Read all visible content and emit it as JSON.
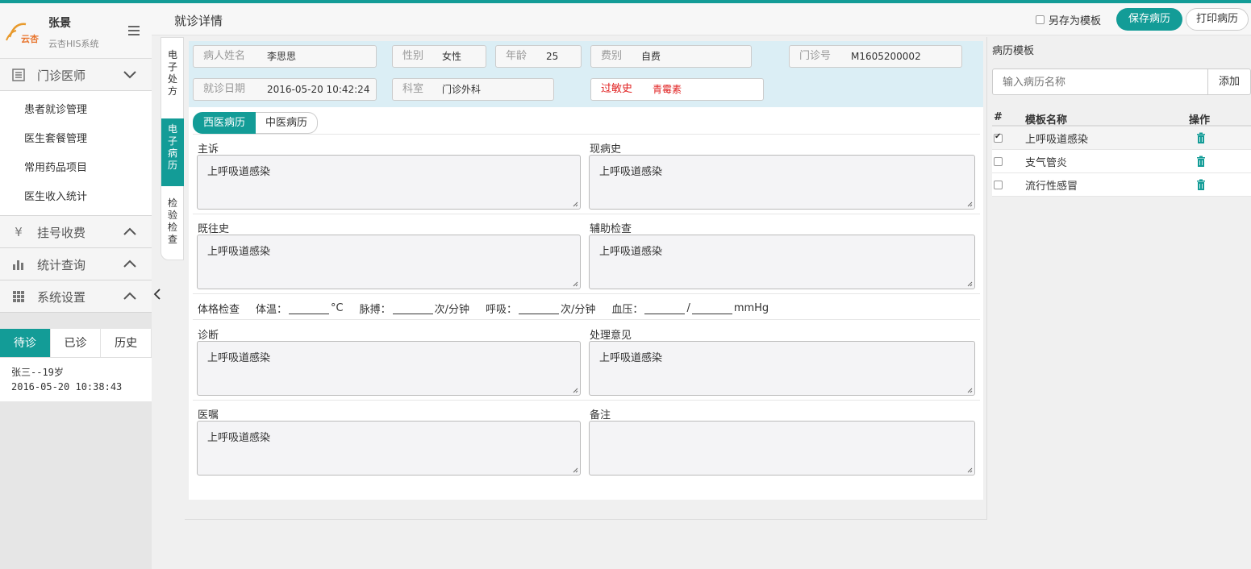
{
  "colors": {
    "accent": "#139c97",
    "allergy": "#e02020"
  },
  "sidebar": {
    "logo_text": "云杏",
    "user_name": "张景",
    "system_name": "云杏HIS系统",
    "groups": [
      {
        "label": "门诊医师",
        "icon": "list-icon",
        "expanded": true,
        "items": [
          "患者就诊管理",
          "医生套餐管理",
          "常用药品项目",
          "医生收入统计"
        ]
      },
      {
        "label": "挂号收费",
        "icon": "yen-icon",
        "expanded": false
      },
      {
        "label": "统计查询",
        "icon": "bar-chart-icon",
        "expanded": false
      },
      {
        "label": "系统设置",
        "icon": "grid-icon",
        "expanded": false
      }
    ],
    "tabs": [
      "待诊",
      "已诊",
      "历史"
    ],
    "active_tab": "待诊",
    "patient": {
      "name_line": "张三--19岁",
      "time": "2016-05-20 10:38:43"
    }
  },
  "header": {
    "title": "就诊详情",
    "save_as_template": "另存为模板",
    "save_button": "保存病历",
    "print_button": "打印病历"
  },
  "vtabs": [
    "电子处方",
    "电子病历",
    "检验检查"
  ],
  "active_vtab": "电子病历",
  "patient_info": {
    "name_label": "病人姓名",
    "name": "李思思",
    "gender_label": "性别",
    "gender": "女性",
    "age_label": "年龄",
    "age": "25",
    "fee_label": "费别",
    "fee": "自费",
    "clinic_no_label": "门诊号",
    "clinic_no": "M1605200002",
    "visit_date_label": "就诊日期",
    "visit_date": "2016-05-20 10:42:24",
    "dept_label": "科室",
    "dept": "门诊外科",
    "allergy_label": "过敏史",
    "allergy": "青霉素"
  },
  "record": {
    "tabs": [
      "西医病历",
      "中医病历"
    ],
    "active_tab": "西医病历",
    "fields": {
      "chief_complaint": {
        "label": "主诉",
        "value": "上呼吸道感染"
      },
      "present_illness": {
        "label": "现病史",
        "value": "上呼吸道感染"
      },
      "past_history": {
        "label": "既往史",
        "value": "上呼吸道感染"
      },
      "auxiliary_exam": {
        "label": "辅助检查",
        "value": "上呼吸道感染"
      },
      "diagnosis": {
        "label": "诊断",
        "value": "上呼吸道感染"
      },
      "treatment": {
        "label": "处理意见",
        "value": "上呼吸道感染"
      },
      "doctor_advice": {
        "label": "医嘱",
        "value": "上呼吸道感染"
      },
      "remarks": {
        "label": "备注",
        "value": ""
      }
    },
    "vitals": {
      "label": "体格检查",
      "temp_label": "体温：",
      "temp_unit": "°C",
      "pulse_label": "脉搏：",
      "pulse_unit": "次/分钟",
      "resp_label": "呼吸：",
      "resp_unit": "次/分钟",
      "bp_label": "血压：",
      "bp_sep": "/",
      "bp_unit": "mmHg"
    }
  },
  "templates": {
    "title": "病历模板",
    "input_placeholder": "输入病历名称",
    "add_button": "添加",
    "columns": [
      "#",
      "模板名称",
      "操作"
    ],
    "rows": [
      {
        "name": "上呼吸道感染",
        "checked": true
      },
      {
        "name": "支气管炎",
        "checked": false
      },
      {
        "name": "流行性感冒",
        "checked": false
      }
    ]
  }
}
